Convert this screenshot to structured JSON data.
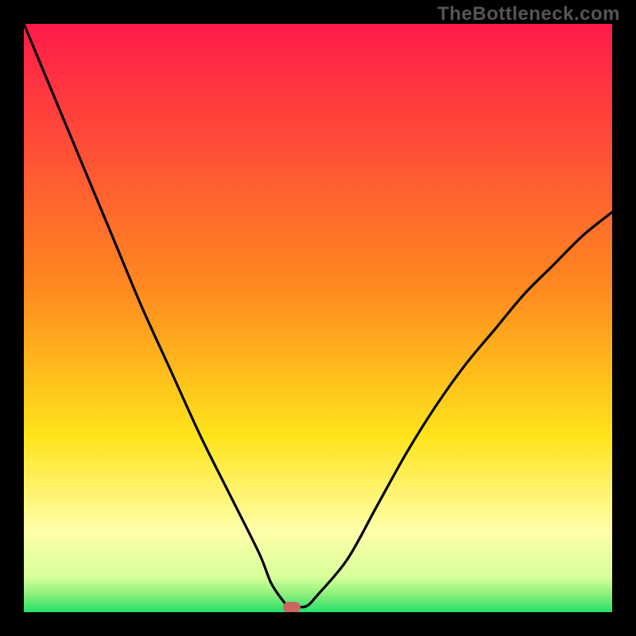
{
  "watermark": "TheBottleneck.com",
  "chart_data": {
    "type": "line",
    "title": "",
    "xlabel": "",
    "ylabel": "",
    "xlim": [
      0,
      100
    ],
    "ylim": [
      0,
      100
    ],
    "gradient_stops": [
      {
        "offset": 0,
        "color": "#ff1a4b"
      },
      {
        "offset": 0.45,
        "color": "#ff8a1f"
      },
      {
        "offset": 0.7,
        "color": "#ffe31a"
      },
      {
        "offset": 0.86,
        "color": "#ffffa8"
      },
      {
        "offset": 0.94,
        "color": "#d8ff9a"
      },
      {
        "offset": 0.97,
        "color": "#8af07a"
      },
      {
        "offset": 1.0,
        "color": "#25e06b"
      }
    ],
    "series": [
      {
        "name": "bottleneck-curve",
        "x": [
          0,
          5,
          10,
          15,
          20,
          25,
          30,
          35,
          40,
          42,
          44,
          45,
          46,
          48,
          50,
          55,
          60,
          65,
          70,
          75,
          80,
          85,
          90,
          95,
          100
        ],
        "y": [
          100,
          88,
          76,
          64,
          52,
          41,
          30,
          20,
          10,
          5,
          2,
          1,
          1,
          1,
          3,
          9,
          18,
          27,
          35,
          42,
          48,
          54,
          59,
          64,
          68
        ]
      }
    ],
    "marker": {
      "x": 45.5,
      "y": 0.8,
      "color": "#c9675f"
    }
  }
}
